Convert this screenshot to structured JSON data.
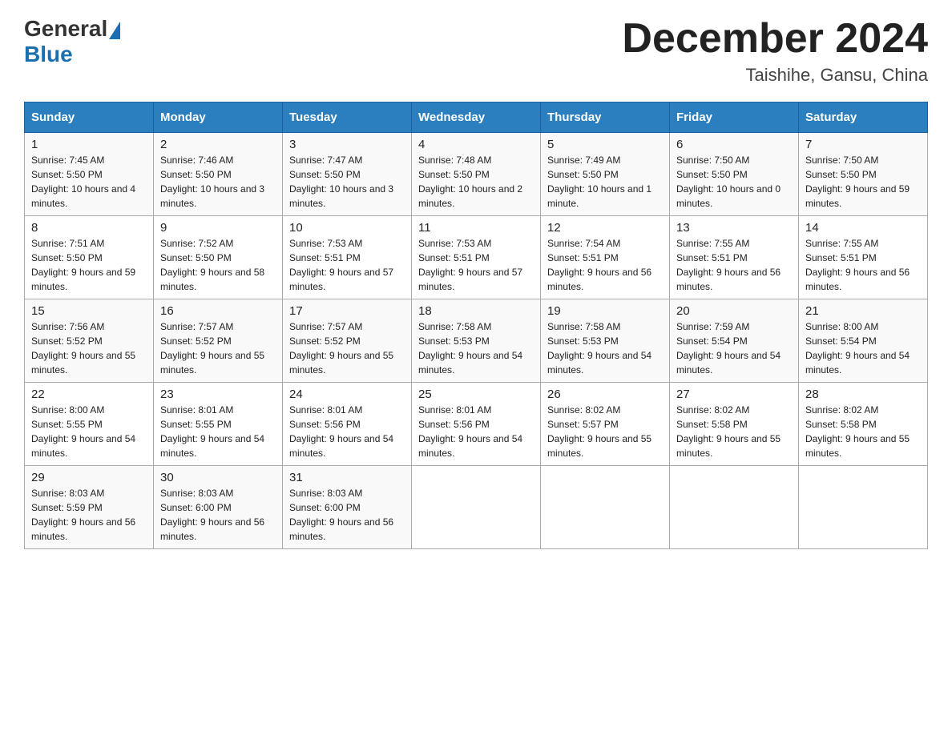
{
  "header": {
    "logo_general": "General",
    "logo_blue": "Blue",
    "month_year": "December 2024",
    "location": "Taishihe, Gansu, China"
  },
  "days_of_week": [
    "Sunday",
    "Monday",
    "Tuesday",
    "Wednesday",
    "Thursday",
    "Friday",
    "Saturday"
  ],
  "weeks": [
    [
      {
        "day": "1",
        "sunrise": "7:45 AM",
        "sunset": "5:50 PM",
        "daylight": "10 hours and 4 minutes."
      },
      {
        "day": "2",
        "sunrise": "7:46 AM",
        "sunset": "5:50 PM",
        "daylight": "10 hours and 3 minutes."
      },
      {
        "day": "3",
        "sunrise": "7:47 AM",
        "sunset": "5:50 PM",
        "daylight": "10 hours and 3 minutes."
      },
      {
        "day": "4",
        "sunrise": "7:48 AM",
        "sunset": "5:50 PM",
        "daylight": "10 hours and 2 minutes."
      },
      {
        "day": "5",
        "sunrise": "7:49 AM",
        "sunset": "5:50 PM",
        "daylight": "10 hours and 1 minute."
      },
      {
        "day": "6",
        "sunrise": "7:50 AM",
        "sunset": "5:50 PM",
        "daylight": "10 hours and 0 minutes."
      },
      {
        "day": "7",
        "sunrise": "7:50 AM",
        "sunset": "5:50 PM",
        "daylight": "9 hours and 59 minutes."
      }
    ],
    [
      {
        "day": "8",
        "sunrise": "7:51 AM",
        "sunset": "5:50 PM",
        "daylight": "9 hours and 59 minutes."
      },
      {
        "day": "9",
        "sunrise": "7:52 AM",
        "sunset": "5:50 PM",
        "daylight": "9 hours and 58 minutes."
      },
      {
        "day": "10",
        "sunrise": "7:53 AM",
        "sunset": "5:51 PM",
        "daylight": "9 hours and 57 minutes."
      },
      {
        "day": "11",
        "sunrise": "7:53 AM",
        "sunset": "5:51 PM",
        "daylight": "9 hours and 57 minutes."
      },
      {
        "day": "12",
        "sunrise": "7:54 AM",
        "sunset": "5:51 PM",
        "daylight": "9 hours and 56 minutes."
      },
      {
        "day": "13",
        "sunrise": "7:55 AM",
        "sunset": "5:51 PM",
        "daylight": "9 hours and 56 minutes."
      },
      {
        "day": "14",
        "sunrise": "7:55 AM",
        "sunset": "5:51 PM",
        "daylight": "9 hours and 56 minutes."
      }
    ],
    [
      {
        "day": "15",
        "sunrise": "7:56 AM",
        "sunset": "5:52 PM",
        "daylight": "9 hours and 55 minutes."
      },
      {
        "day": "16",
        "sunrise": "7:57 AM",
        "sunset": "5:52 PM",
        "daylight": "9 hours and 55 minutes."
      },
      {
        "day": "17",
        "sunrise": "7:57 AM",
        "sunset": "5:52 PM",
        "daylight": "9 hours and 55 minutes."
      },
      {
        "day": "18",
        "sunrise": "7:58 AM",
        "sunset": "5:53 PM",
        "daylight": "9 hours and 54 minutes."
      },
      {
        "day": "19",
        "sunrise": "7:58 AM",
        "sunset": "5:53 PM",
        "daylight": "9 hours and 54 minutes."
      },
      {
        "day": "20",
        "sunrise": "7:59 AM",
        "sunset": "5:54 PM",
        "daylight": "9 hours and 54 minutes."
      },
      {
        "day": "21",
        "sunrise": "8:00 AM",
        "sunset": "5:54 PM",
        "daylight": "9 hours and 54 minutes."
      }
    ],
    [
      {
        "day": "22",
        "sunrise": "8:00 AM",
        "sunset": "5:55 PM",
        "daylight": "9 hours and 54 minutes."
      },
      {
        "day": "23",
        "sunrise": "8:01 AM",
        "sunset": "5:55 PM",
        "daylight": "9 hours and 54 minutes."
      },
      {
        "day": "24",
        "sunrise": "8:01 AM",
        "sunset": "5:56 PM",
        "daylight": "9 hours and 54 minutes."
      },
      {
        "day": "25",
        "sunrise": "8:01 AM",
        "sunset": "5:56 PM",
        "daylight": "9 hours and 54 minutes."
      },
      {
        "day": "26",
        "sunrise": "8:02 AM",
        "sunset": "5:57 PM",
        "daylight": "9 hours and 55 minutes."
      },
      {
        "day": "27",
        "sunrise": "8:02 AM",
        "sunset": "5:58 PM",
        "daylight": "9 hours and 55 minutes."
      },
      {
        "day": "28",
        "sunrise": "8:02 AM",
        "sunset": "5:58 PM",
        "daylight": "9 hours and 55 minutes."
      }
    ],
    [
      {
        "day": "29",
        "sunrise": "8:03 AM",
        "sunset": "5:59 PM",
        "daylight": "9 hours and 56 minutes."
      },
      {
        "day": "30",
        "sunrise": "8:03 AM",
        "sunset": "6:00 PM",
        "daylight": "9 hours and 56 minutes."
      },
      {
        "day": "31",
        "sunrise": "8:03 AM",
        "sunset": "6:00 PM",
        "daylight": "9 hours and 56 minutes."
      },
      null,
      null,
      null,
      null
    ]
  ],
  "labels": {
    "sunrise": "Sunrise:",
    "sunset": "Sunset:",
    "daylight": "Daylight:"
  }
}
